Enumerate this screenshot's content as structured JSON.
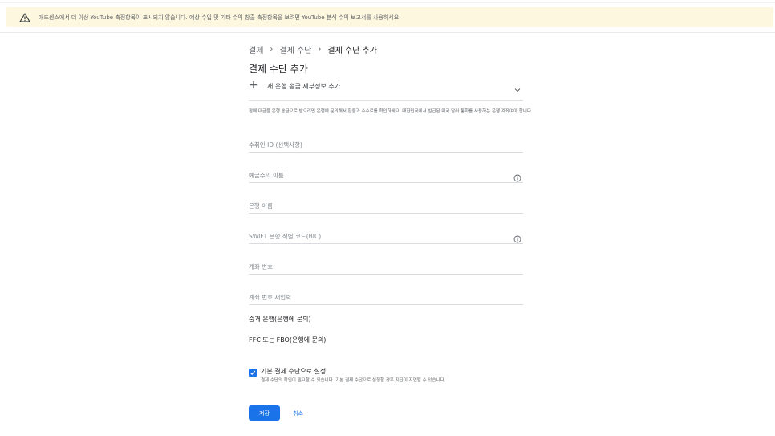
{
  "banner": {
    "icon": "warning-icon",
    "message": "애드센스에서 더 이상 YouTube 측정항목이 표시되지 않습니다. 예상 수입 및 기타 수익 창출 측정항목을 보려면 YouTube 분석 수익 보고서를 사용하세요."
  },
  "breadcrumb": {
    "items": [
      "결제",
      "결제 수단",
      "결제 수단 추가"
    ],
    "separator": "›"
  },
  "page_title": "결제 수단 추가",
  "add_bank": {
    "plus": "+",
    "label": "새 은행 송금 세부정보 추가"
  },
  "info_text": "판매 대금을 은행 송금으로 받으려면 은행에 문의해서 환율과 수수료를 확인하세요. 대한민국에서 발급된 미국 달러 통화를 사용하는 은행 계좌여야 합니다.",
  "fields": {
    "payee_id": "수취인 ID (선택사항)",
    "account_holder": "예금주의 이름",
    "bank_name": "은행 이름",
    "swift": "SWIFT 은행 식별 코드(BIC)",
    "account_number": "계좌 번호",
    "account_number_confirm": "계좌 번호 재입력"
  },
  "static": {
    "intermediary": "중개 은행(은행에 문의)",
    "ffc": "FFC 또는 FBO(은행에 문의)"
  },
  "default_payment": {
    "checked": true,
    "label": "기본 결제 수단으로 설정",
    "sub": "결제 수단의 확인이 필요할 수 있습니다. 기본 결제 수단으로 설정할 경우 지급이 지연될 수 있습니다."
  },
  "buttons": {
    "save": "저장",
    "cancel": "취소"
  },
  "colors": {
    "accent": "#1a73e8",
    "banner_bg": "#fef7e0"
  }
}
